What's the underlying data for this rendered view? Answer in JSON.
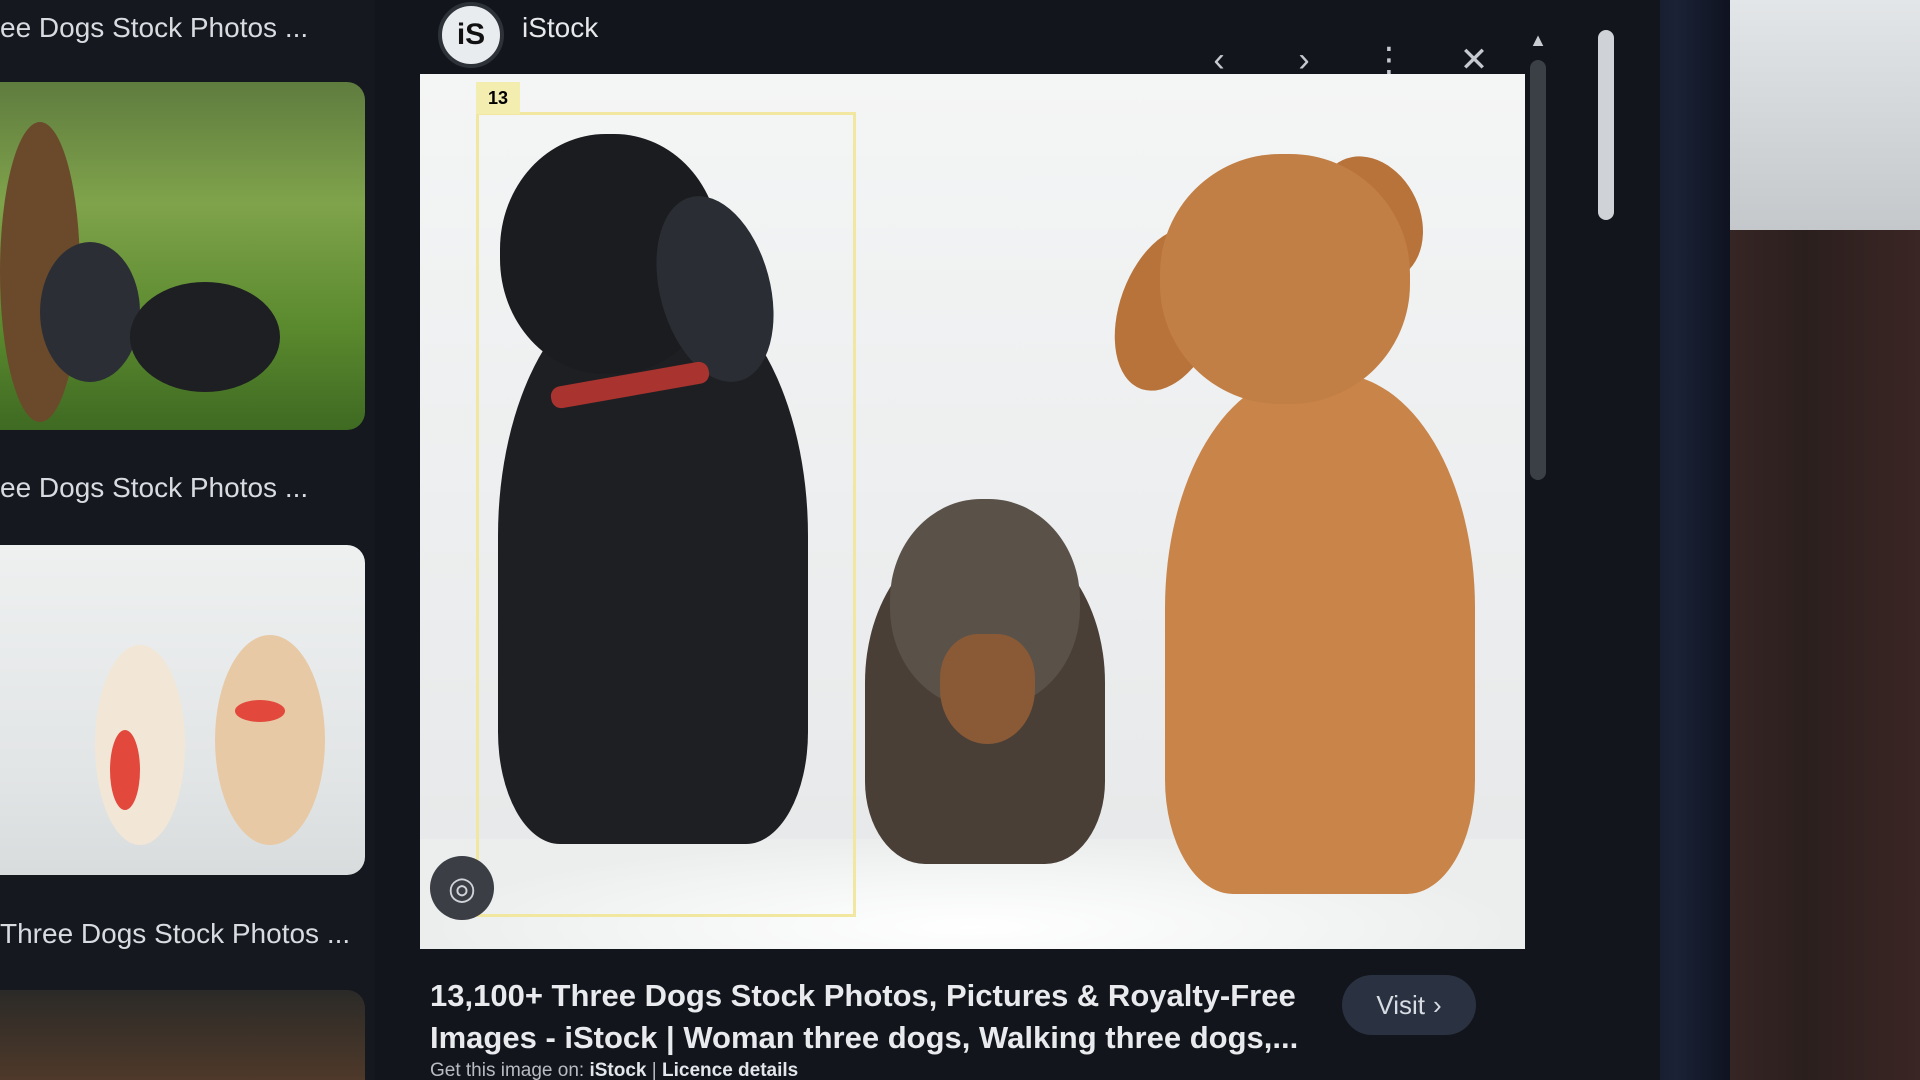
{
  "left_results": {
    "items": [
      {
        "title": "ee Dogs Stock Photos ..."
      },
      {
        "title": "ee Dogs Stock Photos ..."
      },
      {
        "title": "Three Dogs Stock Photos ..."
      }
    ]
  },
  "viewer": {
    "site_logo": "iS",
    "site_name": "iStock",
    "nav_icons": {
      "prev": "chevron-left-icon",
      "next": "chevron-right-icon",
      "more": "more-vert-icon",
      "close": "close-icon"
    },
    "prev_glyph": "‹",
    "next_glyph": "›",
    "more_glyph": "⋮",
    "close_glyph": "✕",
    "selection_tag": "13",
    "lens_glyph": "◎"
  },
  "caption": {
    "title": "13,100+ Three Dogs Stock Photos, Pictures & Royalty-Free Images - iStock | Woman three dogs, Walking three dogs,...",
    "source_prefix": "Get this image on:",
    "source_site": "iStock",
    "separator": "|",
    "licence_link": "Licence details"
  },
  "visit_button": {
    "label": "Visit",
    "glyph": "›"
  },
  "colors": {
    "selection": "#f1e7a1",
    "background": "#12151b",
    "visit_bg": "#2a3140"
  }
}
